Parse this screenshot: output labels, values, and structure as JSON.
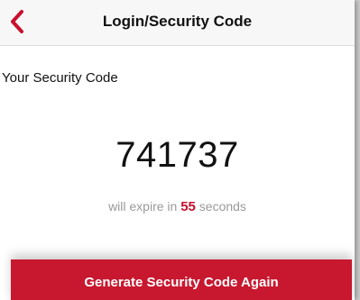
{
  "header": {
    "title": "Login/Security Code",
    "back_icon": "chevron-left-icon",
    "accent_color": "#c8102e"
  },
  "content": {
    "section_label": "Your Security Code",
    "code": "741737",
    "expire_prefix": "will expire in",
    "expire_seconds": "55",
    "expire_suffix": "seconds"
  },
  "actions": {
    "generate_label": "Generate Security Code Again",
    "button_color": "#c8182f"
  }
}
